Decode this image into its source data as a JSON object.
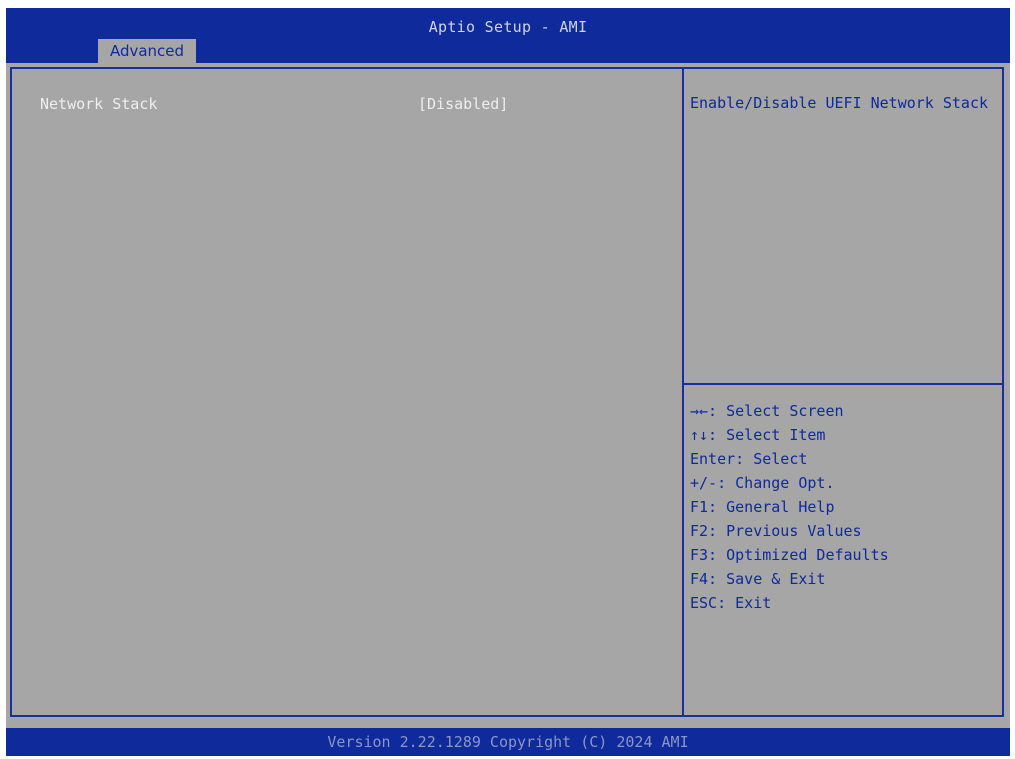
{
  "header": {
    "title": "Aptio Setup - AMI",
    "active_tab": "Advanced"
  },
  "settings": [
    {
      "label": "Network Stack",
      "value": "[Disabled]"
    }
  ],
  "help": {
    "text": "Enable/Disable UEFI Network Stack"
  },
  "key_legend": [
    "→←: Select Screen",
    "↑↓: Select Item",
    "Enter: Select",
    "+/-: Change Opt.",
    "F1: General Help",
    "F2: Previous Values",
    "F3: Optimized Defaults",
    "F4: Save & Exit",
    "ESC: Exit"
  ],
  "footer": {
    "version": "Version 2.22.1289 Copyright (C) 2024 AMI"
  },
  "colors": {
    "bar_blue": "#0f2a9a",
    "panel_gray": "#a6a6a6",
    "help_text_blue": "#0f2a9a",
    "setting_text_white": "#eeeeee"
  }
}
